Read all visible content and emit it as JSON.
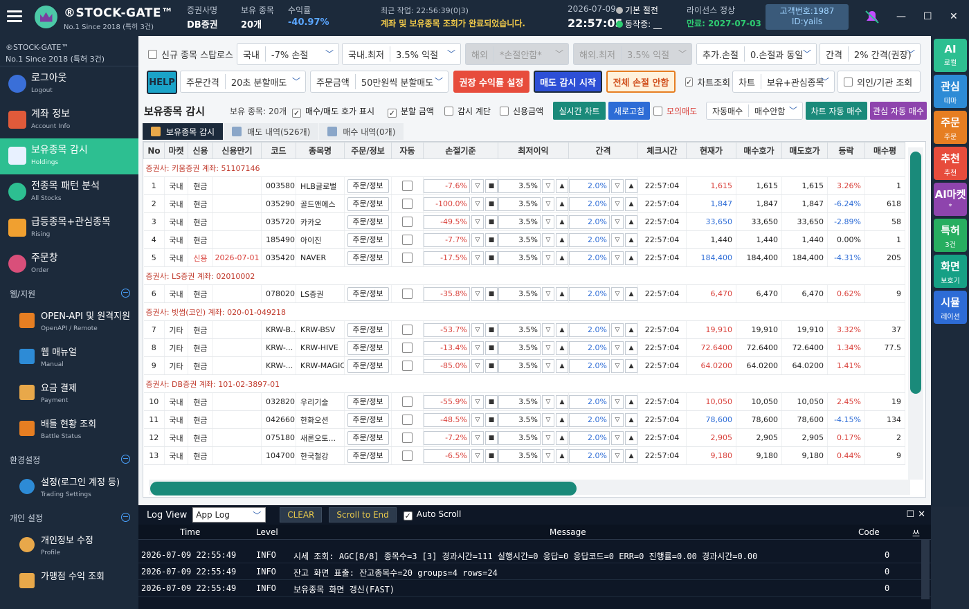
{
  "app": {
    "brand": "®STOCK-GATE™",
    "brand_sub": "No.1 Since 2018 (특허 3건)",
    "broker_label": "증권사명",
    "broker": "DB증권",
    "holdings_label": "보유 종목",
    "holdings": "20개",
    "yield_label": "수익률",
    "yield": "-40.97%",
    "recent_label": "최근 작업: 22:56:39(0|3)",
    "recent_msg": "계좌 및 보유종목 조회가 완료되었습니다.",
    "date": "2026-07-09",
    "clock": "22:57:05",
    "mode": "기본 절전",
    "status": "동작중: __",
    "license_label": "라이선스 정상",
    "license_exp": "만료: 2027-07-03",
    "customer_no": "고객번호:1987",
    "customer_id": "ID:yails"
  },
  "sidebar": {
    "brand": "®STOCK-GATE™",
    "brand_sub": "No.1 Since 2018 (특허 3건)",
    "items": [
      {
        "label": "로그아웃",
        "sub": "Logout"
      },
      {
        "label": "계좌 정보",
        "sub": "Account Info"
      },
      {
        "label": "보유종목 감시",
        "sub": "Holdings"
      },
      {
        "label": "전종목 패턴 분석",
        "sub": "All Stocks"
      },
      {
        "label": "급등종목+관심종목",
        "sub": "Rising"
      },
      {
        "label": "주문창",
        "sub": "Order"
      }
    ],
    "section_web": "웹/지원",
    "web_items": [
      {
        "label": "OPEN-API 및 원격지원",
        "sub": "OpenAPI / Remote"
      },
      {
        "label": "웹 매뉴얼",
        "sub": "Manual"
      },
      {
        "label": "요금 결제",
        "sub": "Payment"
      },
      {
        "label": "배틀 현황 조회",
        "sub": "Battle Status"
      }
    ],
    "section_env": "환경설정",
    "env_items": [
      {
        "label": "설정(로그인 계정 등)",
        "sub": "Trading Settings"
      }
    ],
    "section_personal": "개인 설정",
    "personal_items": [
      {
        "label": "개인정보 수정",
        "sub": "Profile"
      },
      {
        "label": "가맹점 수익 조회",
        "sub": ""
      }
    ]
  },
  "controls": {
    "startup": "신규 종목 스탑로스",
    "domestic_label": "국내",
    "domestic_val": "-7% 손절",
    "domestic_min_label": "국내.최저",
    "domestic_min_val": "3.5% 익절",
    "overseas_label": "해외",
    "overseas_val": "*손절안함*",
    "overseas_min_label": "해외.최저",
    "overseas_min_val": "3.5% 익절",
    "add_label": "추가.손절",
    "add_val": "0.손절과 동일",
    "gap_label": "간격",
    "gap_val": "2% 간격(권장)",
    "help": "HELP",
    "order_gap_label": "주문간격",
    "order_gap_val": "20초 분할매도",
    "order_amt_label": "주문금액",
    "order_amt_val": "50만원씩 분할매도",
    "btn_profit": "권장 수익률 설정",
    "btn_watch": "매도 감시 시작",
    "btn_nostop": "전체 손절 안함",
    "chart_check": "차트조회",
    "chart_label": "차트",
    "chart_val": "보유+관심종목",
    "foreign": "외인/기관 조회"
  },
  "panel": {
    "title": "보유종목 감시",
    "count": "보유 종목: 20개",
    "opt1": "매수/매도 호가 표시",
    "opt2": "분할 금액",
    "opt3": "감시 계단",
    "opt4": "신용금액",
    "btn_rt": "실시간 차트",
    "btn_refresh": "새로고침",
    "opt5": "모의매도",
    "auto_label": "자동매수",
    "auto_val": "매수안함",
    "btn_chart_auto": "차트 자동 매수",
    "btn_fav_auto": "관심 자동 매수"
  },
  "tabs": [
    "보유종목 감시",
    "매도 내역(526개)",
    "매수 내역(0개)"
  ],
  "table": {
    "headers": [
      "No",
      "마켓",
      "신용",
      "신용만기",
      "코드",
      "종목명",
      "주문/정보",
      "자동",
      "손절기준",
      "최저이익",
      "간격",
      "체크시간",
      "현재가",
      "매수호가",
      "매도호가",
      "등락",
      "매수평"
    ],
    "groups": [
      {
        "label": "증권사: 키움증권   계좌: 51107146",
        "rows": [
          {
            "no": "1",
            "mkt": "국내",
            "cr": "현금",
            "exp": "",
            "code": "003580",
            "name": "HLB글로벌",
            "stop": "-7.6%",
            "min": "3.5%",
            "gap": "2.0%",
            "time": "22:57:04",
            "price": "1,615",
            "bid": "1,615",
            "ask": "1,615",
            "chg": "3.26%",
            "avg": "1",
            "dir": "up"
          },
          {
            "no": "2",
            "mkt": "국내",
            "cr": "현금",
            "exp": "",
            "code": "035290",
            "name": "골드앤에스",
            "stop": "-100.0%",
            "min": "3.5%",
            "gap": "2.0%",
            "time": "22:57:04",
            "price": "1,847",
            "bid": "1,847",
            "ask": "1,847",
            "chg": "-6.24%",
            "avg": "618",
            "dir": "dn"
          },
          {
            "no": "3",
            "mkt": "국내",
            "cr": "현금",
            "exp": "",
            "code": "035720",
            "name": "카카오",
            "stop": "-49.5%",
            "min": "3.5%",
            "gap": "2.0%",
            "time": "22:57:04",
            "price": "33,650",
            "bid": "33,650",
            "ask": "33,650",
            "chg": "-2.89%",
            "avg": "58",
            "dir": "dn"
          },
          {
            "no": "4",
            "mkt": "국내",
            "cr": "현금",
            "exp": "",
            "code": "185490",
            "name": "아이진",
            "stop": "-7.7%",
            "min": "3.5%",
            "gap": "2.0%",
            "time": "22:57:04",
            "price": "1,440",
            "bid": "1,440",
            "ask": "1,440",
            "chg": "0.00%",
            "avg": "1",
            "dir": "flat"
          },
          {
            "no": "5",
            "mkt": "국내",
            "cr": "신용",
            "exp": "2026-07-01",
            "code": "035420",
            "name": "NAVER",
            "stop": "-17.5%",
            "min": "3.5%",
            "gap": "2.0%",
            "time": "22:57:04",
            "price": "184,400",
            "bid": "184,400",
            "ask": "184,400",
            "chg": "-4.31%",
            "avg": "205",
            "dir": "dn"
          }
        ]
      },
      {
        "label": "증권사: LS증권   계좌: 02010002",
        "rows": [
          {
            "no": "6",
            "mkt": "국내",
            "cr": "현금",
            "exp": "",
            "code": "078020",
            "name": "LS증권",
            "stop": "-35.8%",
            "min": "3.5%",
            "gap": "2.0%",
            "time": "22:57:04",
            "price": "6,470",
            "bid": "6,470",
            "ask": "6,470",
            "chg": "0.62%",
            "avg": "9",
            "dir": "up"
          }
        ]
      },
      {
        "label": "증권사: 빗썸(코인)   계좌: 020-01-049218",
        "rows": [
          {
            "no": "7",
            "mkt": "기타",
            "cr": "현금",
            "exp": "",
            "code": "KRW-B...",
            "name": "KRW-BSV",
            "stop": "-53.7%",
            "min": "3.5%",
            "gap": "2.0%",
            "time": "22:57:04",
            "price": "19,910",
            "bid": "19,910",
            "ask": "19,910",
            "chg": "3.32%",
            "avg": "37",
            "dir": "up"
          },
          {
            "no": "8",
            "mkt": "기타",
            "cr": "현금",
            "exp": "",
            "code": "KRW-...",
            "name": "KRW-HIVE",
            "stop": "-13.4%",
            "min": "3.5%",
            "gap": "2.0%",
            "time": "22:57:04",
            "price": "72.6400",
            "bid": "72.6400",
            "ask": "72.6400",
            "chg": "1.34%",
            "avg": "77.5",
            "dir": "up"
          },
          {
            "no": "9",
            "mkt": "기타",
            "cr": "현금",
            "exp": "",
            "code": "KRW-...",
            "name": "KRW-MAGIC",
            "stop": "-85.0%",
            "min": "3.5%",
            "gap": "2.0%",
            "time": "22:57:04",
            "price": "64.0200",
            "bid": "64.0200",
            "ask": "64.0200",
            "chg": "1.41%",
            "avg": "",
            "dir": "up"
          }
        ]
      },
      {
        "label": "증권사: DB증권   계좌: 101-02-3897-01",
        "rows": [
          {
            "no": "10",
            "mkt": "국내",
            "cr": "현금",
            "exp": "",
            "code": "032820",
            "name": "우리기술",
            "stop": "-55.9%",
            "min": "3.5%",
            "gap": "2.0%",
            "time": "22:57:04",
            "price": "10,050",
            "bid": "10,050",
            "ask": "10,050",
            "chg": "2.45%",
            "avg": "19",
            "dir": "up"
          },
          {
            "no": "11",
            "mkt": "국내",
            "cr": "현금",
            "exp": "",
            "code": "042660",
            "name": "한화오션",
            "stop": "-48.5%",
            "min": "3.5%",
            "gap": "2.0%",
            "time": "22:57:04",
            "price": "78,600",
            "bid": "78,600",
            "ask": "78,600",
            "chg": "-4.15%",
            "avg": "134",
            "dir": "dn"
          },
          {
            "no": "12",
            "mkt": "국내",
            "cr": "현금",
            "exp": "",
            "code": "075180",
            "name": "새론오토...",
            "stop": "-7.2%",
            "min": "3.5%",
            "gap": "2.0%",
            "time": "22:57:04",
            "price": "2,905",
            "bid": "2,905",
            "ask": "2,905",
            "chg": "0.17%",
            "avg": "2",
            "dir": "up"
          },
          {
            "no": "13",
            "mkt": "국내",
            "cr": "현금",
            "exp": "",
            "code": "104700",
            "name": "한국철강",
            "stop": "-6.5%",
            "min": "3.5%",
            "gap": "2.0%",
            "time": "22:57:04",
            "price": "9,180",
            "bid": "9,180",
            "ask": "9,180",
            "chg": "0.44%",
            "avg": "9",
            "dir": "up"
          }
        ]
      }
    ],
    "order_btn": "주문/정보"
  },
  "rightbar": [
    {
      "a": "AI",
      "b": "로컬",
      "color": "#2dbf91"
    },
    {
      "a": "관심",
      "b": "테마",
      "color": "#2d8bd6"
    },
    {
      "a": "주문",
      "b": "주문",
      "color": "#e67e22"
    },
    {
      "a": "추천",
      "b": "추천",
      "color": "#e74c3c"
    },
    {
      "a": "AI마켓",
      "b": "*",
      "color": "#8e44ad"
    },
    {
      "a": "특허",
      "b": "3건",
      "color": "#27ae60"
    },
    {
      "a": "화면",
      "b": "보호기",
      "color": "#16a085"
    },
    {
      "a": "시뮬",
      "b": "레이션",
      "color": "#2d6cd6"
    }
  ],
  "log": {
    "title": "Log View",
    "select": "App Log",
    "clear": "CLEAR",
    "scroll_end": "Scroll to End",
    "auto_scroll": "Auto Scroll",
    "headers": [
      "Time",
      "Level",
      "Message",
      "Code",
      "쓰"
    ],
    "rows": [
      {
        "time": "2026-07-09 22:55:49",
        "level": "INFO",
        "msg": "시세 조회: AGC[8/8] 종목수=3 [3] 경과시간=111 실행시간=0 응답=0 응답코드=0 ERR=0 진행률=0.00 경과시간=0.00",
        "code": "0"
      },
      {
        "time": "2026-07-09 22:55:49",
        "level": "INFO",
        "msg": "잔고 화면 표출: 잔고종목수=20 groups=4 rows=24",
        "code": "0"
      },
      {
        "time": "2026-07-09 22:55:49",
        "level": "INFO",
        "msg": "보유종목 화면 갱신(FAST)",
        "code": "0"
      }
    ]
  }
}
